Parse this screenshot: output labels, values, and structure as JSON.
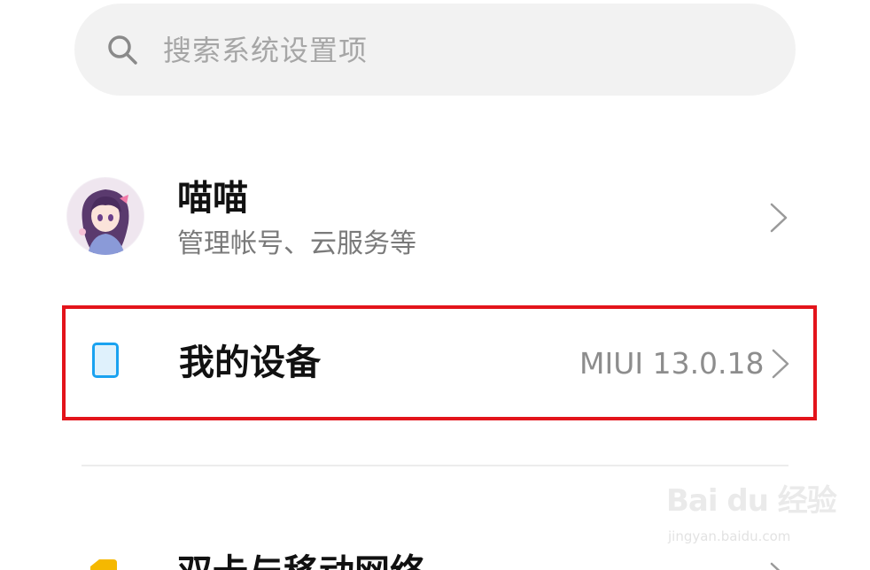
{
  "search": {
    "placeholder": "搜索系统设置项",
    "icon": "search-icon"
  },
  "account": {
    "name": "喵喵",
    "subtitle": "管理帐号、云服务等",
    "avatar": "anime-avatar"
  },
  "device": {
    "title": "我的设备",
    "version": "MIUI 13.0.18",
    "icon": "device-icon",
    "highlight_color": "#e3141b"
  },
  "sim": {
    "title": "双卡与移动网络",
    "icon": "sim-card-icon"
  },
  "watermark": {
    "logo": "Bai du 经验",
    "url": "jingyan.baidu.com"
  },
  "colors": {
    "accent_blue": "#1aa2f0",
    "sim_yellow": "#f5b800"
  }
}
